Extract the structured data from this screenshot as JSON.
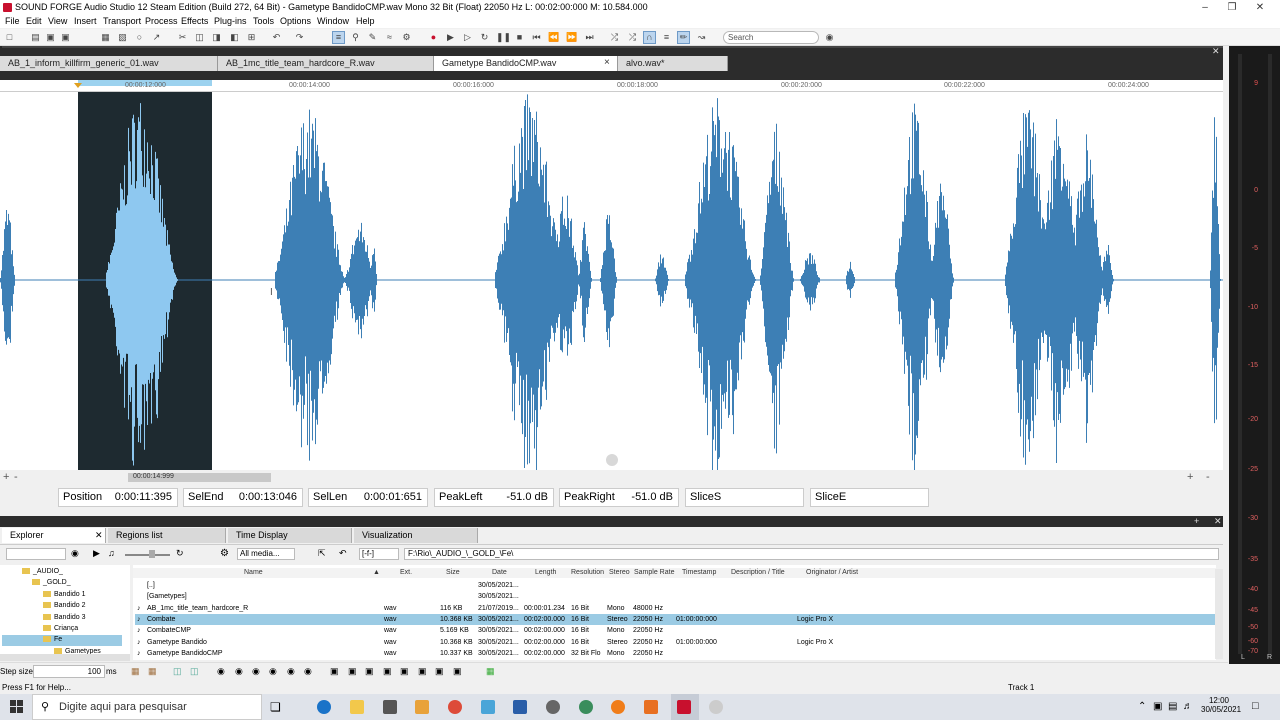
{
  "window": {
    "title": "SOUND FORGE Audio Studio 12 Steam Edition (Build 272, 64 Bit) - Gametype BandidoCMP.wav  Mono 32 Bit (Float) 22050 Hz L: 00:02:00:000 M: 10.584.000"
  },
  "menu": [
    "File",
    "Edit",
    "View",
    "Insert",
    "Transport",
    "Process",
    "Effects",
    "Plug-ins",
    "Tools",
    "Options",
    "Window",
    "Help"
  ],
  "search": {
    "placeholder": "Search"
  },
  "tabs": [
    {
      "label": "AB_1_inform_killfirm_generic_01.wav"
    },
    {
      "label": "AB_1mc_title_team_hardcore_R.wav"
    },
    {
      "label": "Gametype BandidoCMP.wav"
    },
    {
      "label": "alvo.wav*"
    }
  ],
  "tab_close": "×",
  "ruler": [
    "00:00:12:000",
    "00:00:14:000",
    "00:00:16:000",
    "00:00:18:000",
    "00:00:20:000",
    "00:00:22:000",
    "00:00:24:000"
  ],
  "scroll_time": "00:00:14:999",
  "status": {
    "position_label": "Position",
    "position_value": "0:00:11:395",
    "selend_label": "SelEnd",
    "selend_value": "0:00:13:046",
    "sellen_label": "SelLen",
    "sellen_value": "0:00:01:651",
    "peakleft_label": "PeakLeft",
    "peakleft_value": "-51.0 dB",
    "peakright_label": "PeakRight",
    "peakright_value": "-51.0 dB",
    "slices_label": "SliceS",
    "slicee_label": "SliceE"
  },
  "meter": [
    "0",
    "-5",
    "-10",
    "-15",
    "-20",
    "-25",
    "-30",
    "-35",
    "-40",
    "-45",
    "-50",
    "-60",
    "-70"
  ],
  "meter_top": "9",
  "meter_lr": [
    "L",
    "R"
  ],
  "explorer": {
    "tabs": [
      "Explorer",
      "Regions list",
      "Time Display",
      "Visualization"
    ],
    "filter": "All media...",
    "path_short": "[-f-]",
    "path": "F:\\Rio\\_AUDIO_\\_GOLD_\\Fe\\",
    "tree": [
      "_AUDIO_",
      "_GOLD_",
      "Bandido 1",
      "Bandido 2",
      "Bandido 3",
      "Criança",
      "Fe",
      "Gametypes"
    ],
    "headers": [
      "Name",
      "Ext.",
      "Size",
      "Date",
      "Length",
      "Resolution",
      "Stereo",
      "Sample Rate",
      "Timestamp",
      "Description / Title",
      "Originator / Artist"
    ],
    "rows": [
      {
        "name": "[..]",
        "ext": "",
        "size": "",
        "date": "30/05/2021...",
        "length": "",
        "res": "",
        "stereo": "",
        "rate": "",
        "ts": "",
        "orig": ""
      },
      {
        "name": "[Gametypes]",
        "ext": "",
        "size": "",
        "date": "30/05/2021...",
        "length": "",
        "res": "",
        "stereo": "",
        "rate": "",
        "ts": "",
        "orig": ""
      },
      {
        "name": "AB_1mc_title_team_hardcore_R",
        "ext": "wav",
        "size": "116 KB",
        "date": "21/07/2019...",
        "length": "00:00:01.234",
        "res": "16 Bit",
        "stereo": "Mono",
        "rate": "48000 Hz",
        "ts": "",
        "orig": ""
      },
      {
        "name": "Combate",
        "ext": "wav",
        "size": "10.368 KB",
        "date": "30/05/2021...",
        "length": "00:02:00.000",
        "res": "16 Bit",
        "stereo": "Stereo",
        "rate": "22050 Hz",
        "ts": "01:00:00:000",
        "orig": "Logic Pro X"
      },
      {
        "name": "CombateCMP",
        "ext": "wav",
        "size": "5.169 KB",
        "date": "30/05/2021...",
        "length": "00:02:00.000",
        "res": "16 Bit",
        "stereo": "Mono",
        "rate": "22050 Hz",
        "ts": "",
        "orig": ""
      },
      {
        "name": "Gametype Bandido",
        "ext": "wav",
        "size": "10.368 KB",
        "date": "30/05/2021...",
        "length": "00:02:00.000",
        "res": "16 Bit",
        "stereo": "Stereo",
        "rate": "22050 Hz",
        "ts": "01:00:00:000",
        "orig": "Logic Pro X"
      },
      {
        "name": "Gametype BandidoCMP",
        "ext": "wav",
        "size": "10.337 KB",
        "date": "30/05/2021...",
        "length": "00:02:00.000",
        "res": "32 Bit Flo",
        "stereo": "Mono",
        "rate": "22050 Hz",
        "ts": "",
        "orig": ""
      }
    ]
  },
  "stepsize": {
    "label": "Step size",
    "value": "100",
    "unit": "ms"
  },
  "help": "Press F1 for Help...",
  "track": "Track 1",
  "taskbar": {
    "search": "Digite aqui para pesquisar",
    "time": "12:00",
    "date": "30/05/2021"
  },
  "colors": {
    "wave": "#3d7fb5",
    "wave_selected": "#8ec8f0",
    "selection_bg": "#1e2a30",
    "accent": "#c8102e"
  }
}
